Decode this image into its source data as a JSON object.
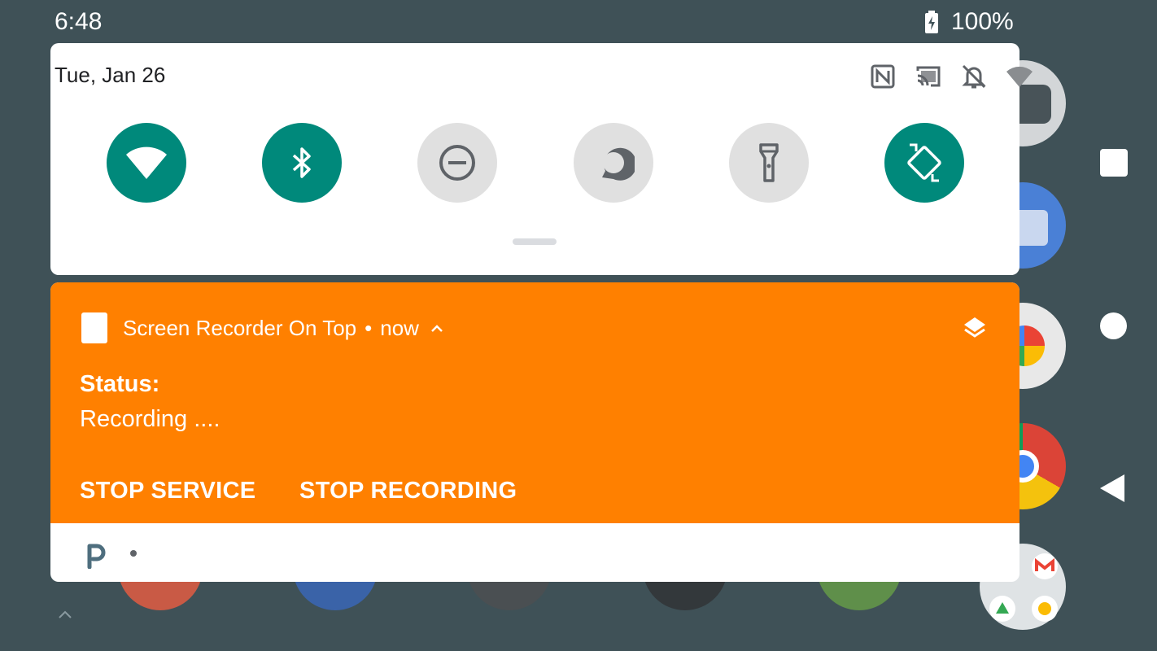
{
  "status_bar": {
    "time": "6:48",
    "battery_percent": "100%",
    "icons": [
      "battery-charging-icon"
    ]
  },
  "quick_settings": {
    "date": "Tue, Jan 26",
    "status_icons": [
      "nfc-icon",
      "cast-icon",
      "notifications-off-icon",
      "wifi-signal-icon"
    ],
    "tiles": [
      {
        "name": "wifi-icon",
        "state": "on"
      },
      {
        "name": "bluetooth-icon",
        "state": "on"
      },
      {
        "name": "do-not-disturb-icon",
        "state": "off"
      },
      {
        "name": "alexa-icon",
        "state": "off"
      },
      {
        "name": "flashlight-icon",
        "state": "off"
      },
      {
        "name": "auto-rotate-icon",
        "state": "on"
      }
    ],
    "active_color": "#00897b",
    "inactive_color": "#e0e0e0"
  },
  "notification": {
    "app_name": "Screen Recorder On Top",
    "separator": "•",
    "time": "now",
    "title": "Status:",
    "text": "Recording ....",
    "actions": {
      "stop_service": "STOP SERVICE",
      "stop_recording": "STOP RECORDING"
    },
    "background_color": "#ff8000"
  },
  "nav_bar": {
    "icons": [
      "recent-apps-icon",
      "home-icon",
      "back-icon"
    ]
  }
}
